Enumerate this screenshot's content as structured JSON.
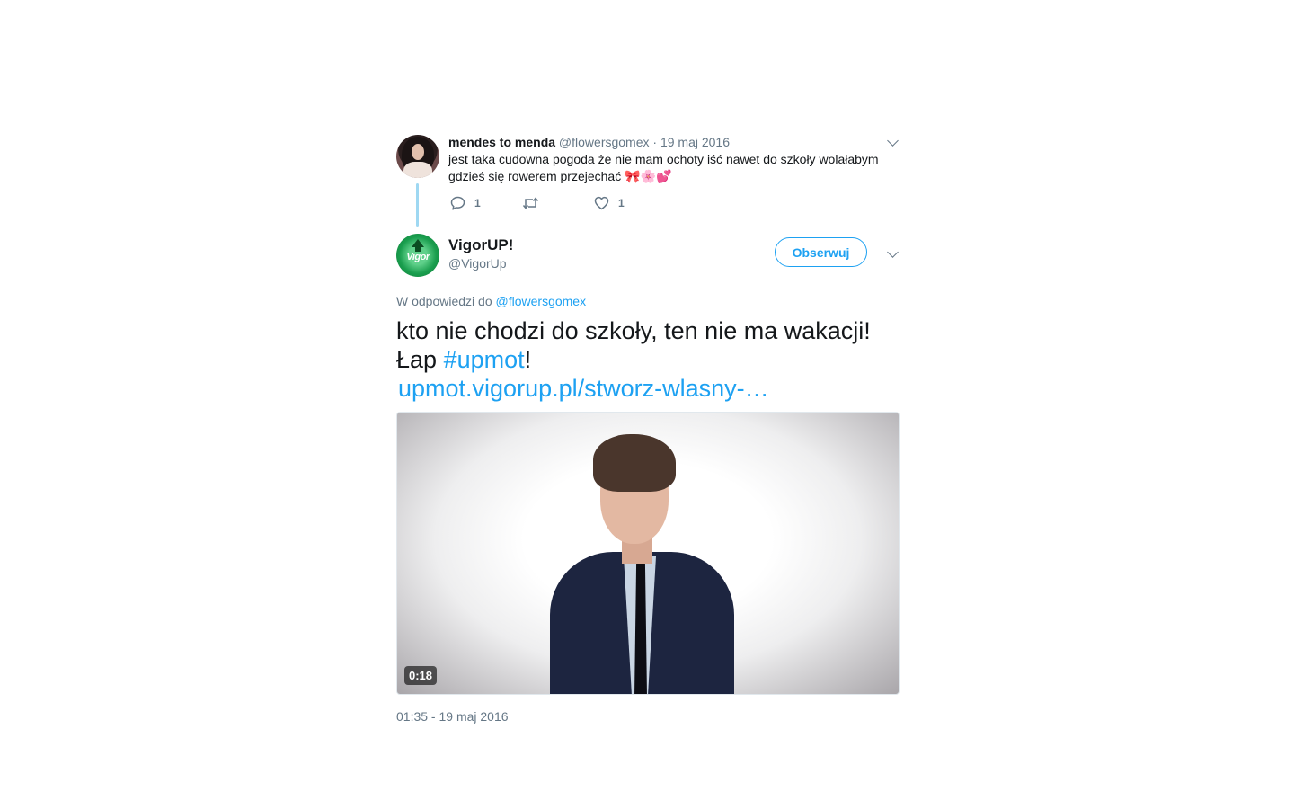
{
  "parent_tweet": {
    "name": "mendes to menda",
    "handle": "@flowersgomex",
    "separator": "·",
    "date": "19 maj 2016",
    "text": "jest taka cudowna pogoda że nie mam ochoty iść nawet do szkoły wolałabym gdzieś się rowerem przejechać 🎀🌸💕",
    "reply_count": "1",
    "retweet_count": "",
    "like_count": "1"
  },
  "main_tweet": {
    "name": "VigorUP!",
    "handle": "@VigorUp",
    "follow_label": "Obserwuj",
    "reply_prefix": "W odpowiedzi do",
    "reply_to_handle": "@flowersgomex",
    "text_line1": "kto nie chodzi do szkoły, ten nie ma wakacji!",
    "text_prefix2": "Łap",
    "hashtag": "#upmot",
    "text_suffix2": "!",
    "link": "upmot.vigorup.pl/stworz-wlasny-…",
    "video_duration": "0:18",
    "timestamp": "01:35 - 19 maj 2016"
  },
  "colors": {
    "accent": "#1da1f2",
    "secondary_text": "#657786",
    "thread_line": "#9fd8f2"
  },
  "icons": {
    "reply": "reply-icon",
    "retweet": "retweet-icon",
    "like": "heart-icon",
    "more": "chevron-down-icon"
  }
}
